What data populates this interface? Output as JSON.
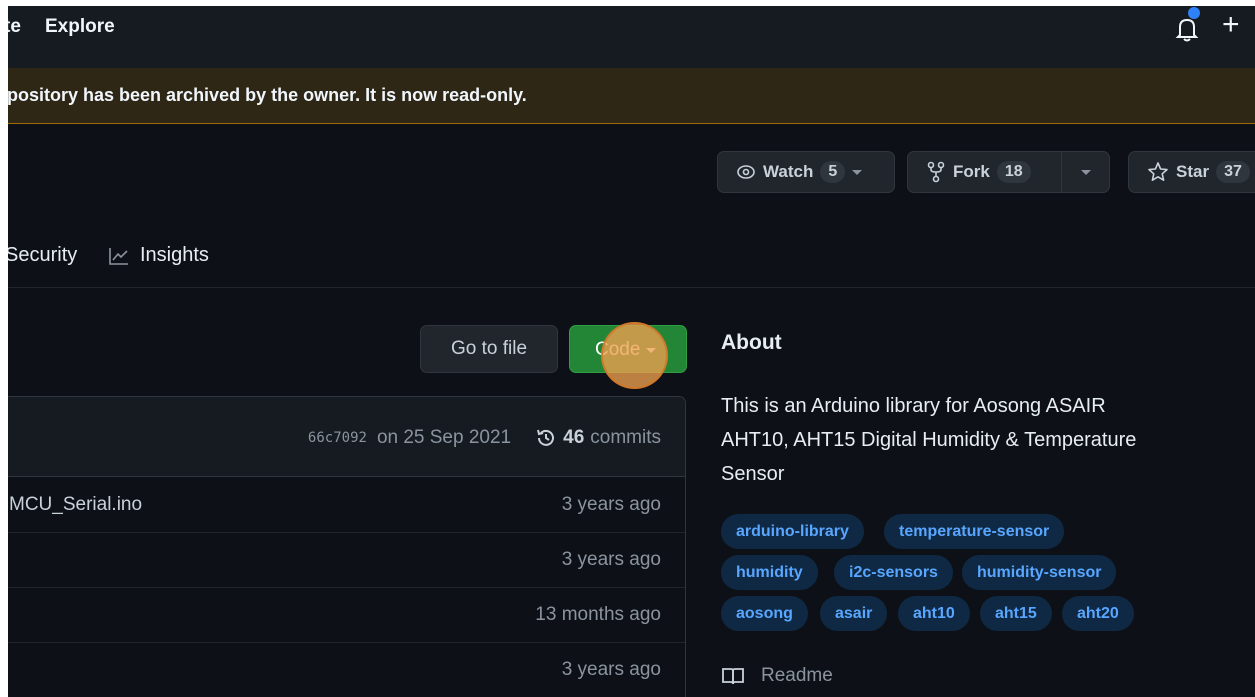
{
  "header": {
    "cut_link": "te",
    "explore": "Explore",
    "plus": "+"
  },
  "banner": {
    "text": "pository has been archived by the owner. It is now read-only."
  },
  "actions": {
    "watch_label": "Watch",
    "watch_count": "5",
    "fork_label": "Fork",
    "fork_count": "18",
    "star_label": "Star",
    "star_count": "37"
  },
  "nav": {
    "security": "Security",
    "insights": "Insights"
  },
  "file_actions": {
    "goto_file": "Go to file",
    "code": "Code"
  },
  "commit": {
    "hash": "66c7092",
    "date": "on 25 Sep 2021",
    "count": "46",
    "commits_label": "commits"
  },
  "files": [
    {
      "name": "MCU_Serial.ino",
      "age": "3 years ago"
    },
    {
      "name": "",
      "age": "3 years ago"
    },
    {
      "name": "",
      "age": "13 months ago"
    },
    {
      "name": "",
      "age": "3 years ago"
    }
  ],
  "about": {
    "title": "About",
    "description": "This is an Arduino library for Aosong ASAIR AHT10, AHT15 Digital Humidity & Temperature Sensor",
    "topics": [
      "arduino-library",
      "temperature-sensor",
      "humidity",
      "i2c-sensors",
      "humidity-sensor",
      "aosong",
      "asair",
      "aht10",
      "aht15",
      "aht20"
    ],
    "readme": "Readme"
  },
  "colors": {
    "background": "#0d1117",
    "banner": "#2f2716",
    "code_button": "#238636",
    "topic_text": "#58a6ff",
    "click_marker": "#f0a050"
  },
  "icons": [
    "bell-icon",
    "plus-icon",
    "eye-icon",
    "fork-icon",
    "star-icon",
    "graph-icon",
    "history-icon",
    "book-icon",
    "caret-down-icon"
  ]
}
